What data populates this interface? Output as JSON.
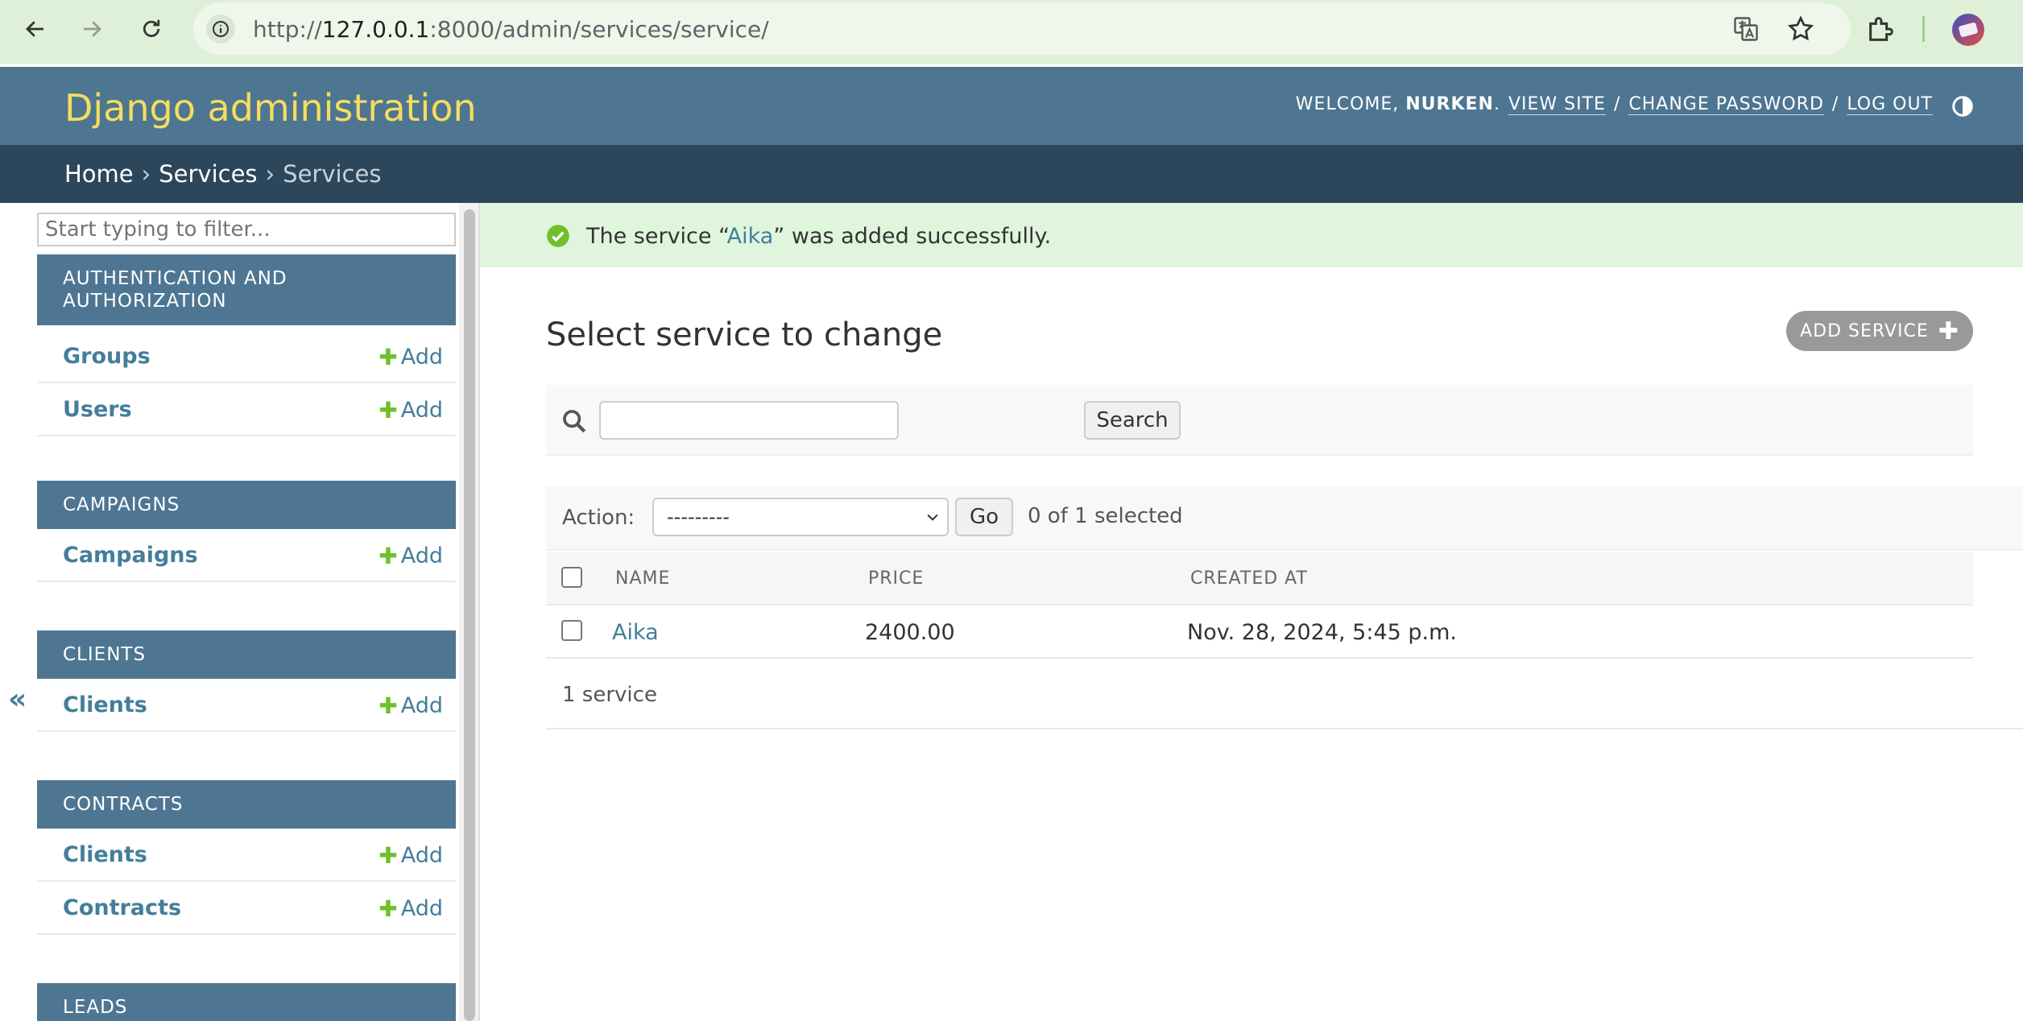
{
  "browser": {
    "url_prefix": "http://",
    "url_host": "127.0.0.1",
    "url_rest": ":8000/admin/services/service/"
  },
  "header": {
    "brand": "Django administration",
    "welcome": "WELCOME,",
    "username": "NURKEN",
    "period": ".",
    "view_site": "VIEW SITE",
    "sep1": "/",
    "change_password": "CHANGE PASSWORD",
    "sep2": "/",
    "log_out": "LOG OUT"
  },
  "breadcrumbs": {
    "home": "Home",
    "sep": "›",
    "app": "Services",
    "current": "Services"
  },
  "sidebar": {
    "filter_placeholder": "Start typing to filter...",
    "collapse": "«",
    "add_label": "Add",
    "modules": [
      {
        "caption": "AUTHENTICATION AND AUTHORIZATION",
        "items": [
          "Groups",
          "Users"
        ]
      },
      {
        "caption": "CAMPAIGNS",
        "items": [
          "Campaigns"
        ]
      },
      {
        "caption": "CLIENTS",
        "items": [
          "Clients"
        ]
      },
      {
        "caption": "CONTRACTS",
        "items": [
          "Clients",
          "Contracts"
        ]
      },
      {
        "caption": "LEADS",
        "items": []
      }
    ]
  },
  "message": {
    "before": "The service “",
    "link": "Aika",
    "after": "” was added successfully."
  },
  "main": {
    "title": "Select service to change",
    "add_button": "ADD SERVICE",
    "search_value": "",
    "search_button": "Search",
    "action_label": "Action:",
    "action_selected": "---------",
    "go_button": "Go",
    "selected_count": "0 of 1 selected",
    "columns": [
      "NAME",
      "PRICE",
      "CREATED AT"
    ],
    "rows": [
      {
        "name": "Aika",
        "price": "2400.00",
        "created_at": "Nov. 28, 2024, 5:45 p.m."
      }
    ],
    "paginator": "1 service"
  },
  "colors": {
    "header_bg": "#4e7692",
    "breadcrumb_bg": "#2c465c",
    "brand": "#f5dd5d",
    "link": "#447e9b",
    "success_bg": "#dff5dc",
    "add_green": "#70bf2b"
  }
}
